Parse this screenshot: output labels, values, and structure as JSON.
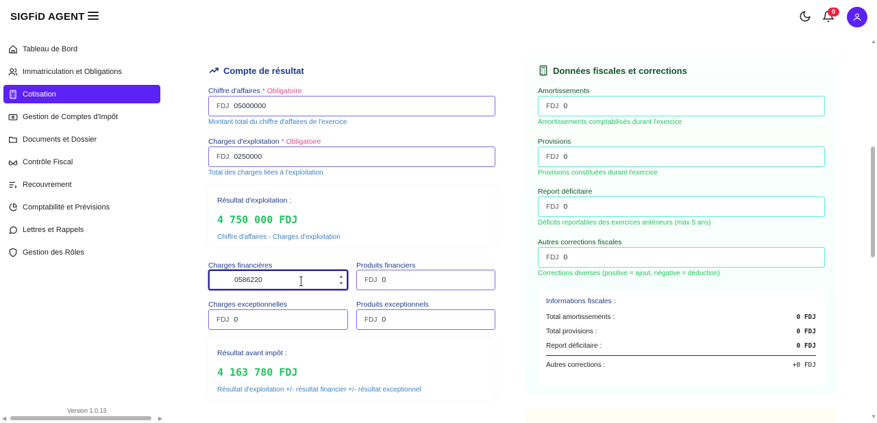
{
  "app": {
    "title": "SIGFiD AGENT",
    "notification_count": "0"
  },
  "sidebar": {
    "items": [
      {
        "label": "Tableau de Bord",
        "icon": "home-icon",
        "active": false
      },
      {
        "label": "Immatriculation et Obligations",
        "icon": "users-icon",
        "active": false
      },
      {
        "label": "Cotisation",
        "icon": "calculator-icon",
        "active": true
      },
      {
        "label": "Gestion de Comptes d'Impôt",
        "icon": "wallet-icon",
        "active": false
      },
      {
        "label": "Documents et Dossier",
        "icon": "folder-icon",
        "active": false
      },
      {
        "label": "Contrôle Fiscal",
        "icon": "glasses-icon",
        "active": false
      },
      {
        "label": "Recouvrement",
        "icon": "list-icon",
        "active": false
      },
      {
        "label": "Comptabilité et Prévisions",
        "icon": "pie-chart-icon",
        "active": false
      },
      {
        "label": "Lettres et Rappels",
        "icon": "message-icon",
        "active": false
      },
      {
        "label": "Gestion des Rôles",
        "icon": "shield-icon",
        "active": false
      }
    ],
    "version": "Version 1.0.13"
  },
  "compte_resultat": {
    "title": "Compte de résultat",
    "required_text": "* Obligatoire",
    "currency_prefix": "FDJ",
    "chiffre_affaires": {
      "label": "Chiffre d'affaires",
      "value": "05000000",
      "help": "Montant total du chiffre d'affaires de l'exercice"
    },
    "charges_exploitation": {
      "label": "Charges d'exploitation",
      "value": "0250000",
      "help": "Total des charges liées à l'exploitation"
    },
    "resultat_exploitation": {
      "label": "Résultat d'exploitation :",
      "value": "4 750 000 FDJ",
      "formula": "Chiffre d'affaires - Charges d'exploitation"
    },
    "charges_financieres": {
      "label": "Charges financières",
      "value": "0586220"
    },
    "produits_financiers": {
      "label": "Produits financiers",
      "value": "0"
    },
    "charges_exceptionnelles": {
      "label": "Charges exceptionnelles",
      "value": "0"
    },
    "produits_exceptionnels": {
      "label": "Produits exceptionnels",
      "value": "0"
    },
    "resultat_avant_impot": {
      "label": "Résultat avant impôt :",
      "value": "4 163 780 FDJ",
      "formula": "Résultat d'exploitation +/- résultat financier +/- résultat exceptionnel"
    }
  },
  "donnees_fiscales": {
    "title": "Données fiscales et corrections",
    "currency_prefix": "FDJ",
    "amortissements": {
      "label": "Amortissements",
      "value": "0",
      "help": "Amortissements comptabilisés durant l'exercice"
    },
    "provisions": {
      "label": "Provisions",
      "value": "0",
      "help": "Provisions constituées durant l'exercice"
    },
    "report_deficitaire": {
      "label": "Report déficitaire",
      "value": "0",
      "help": "Déficits reportables des exercices antérieurs (max 5 ans)"
    },
    "autres_corrections": {
      "label": "Autres corrections fiscales",
      "value": "0",
      "help": "Corrections diverses (positive = ajout, négative = déduction)"
    },
    "informations": {
      "title": "Informations fiscales :",
      "rows": [
        {
          "label": "Total amortissements :",
          "value": "0 FDJ"
        },
        {
          "label": "Total provisions :",
          "value": "0 FDJ"
        },
        {
          "label": "Report déficitaire :",
          "value": "0 FDJ"
        },
        {
          "label": "Autres corrections :",
          "value": "+0 FDJ"
        }
      ]
    }
  },
  "colors": {
    "accent": "#5b21f5",
    "blue_section": "#1e3a8a",
    "green_section": "#14532d",
    "result_green": "#22c55e",
    "notification": "#ef233c"
  }
}
